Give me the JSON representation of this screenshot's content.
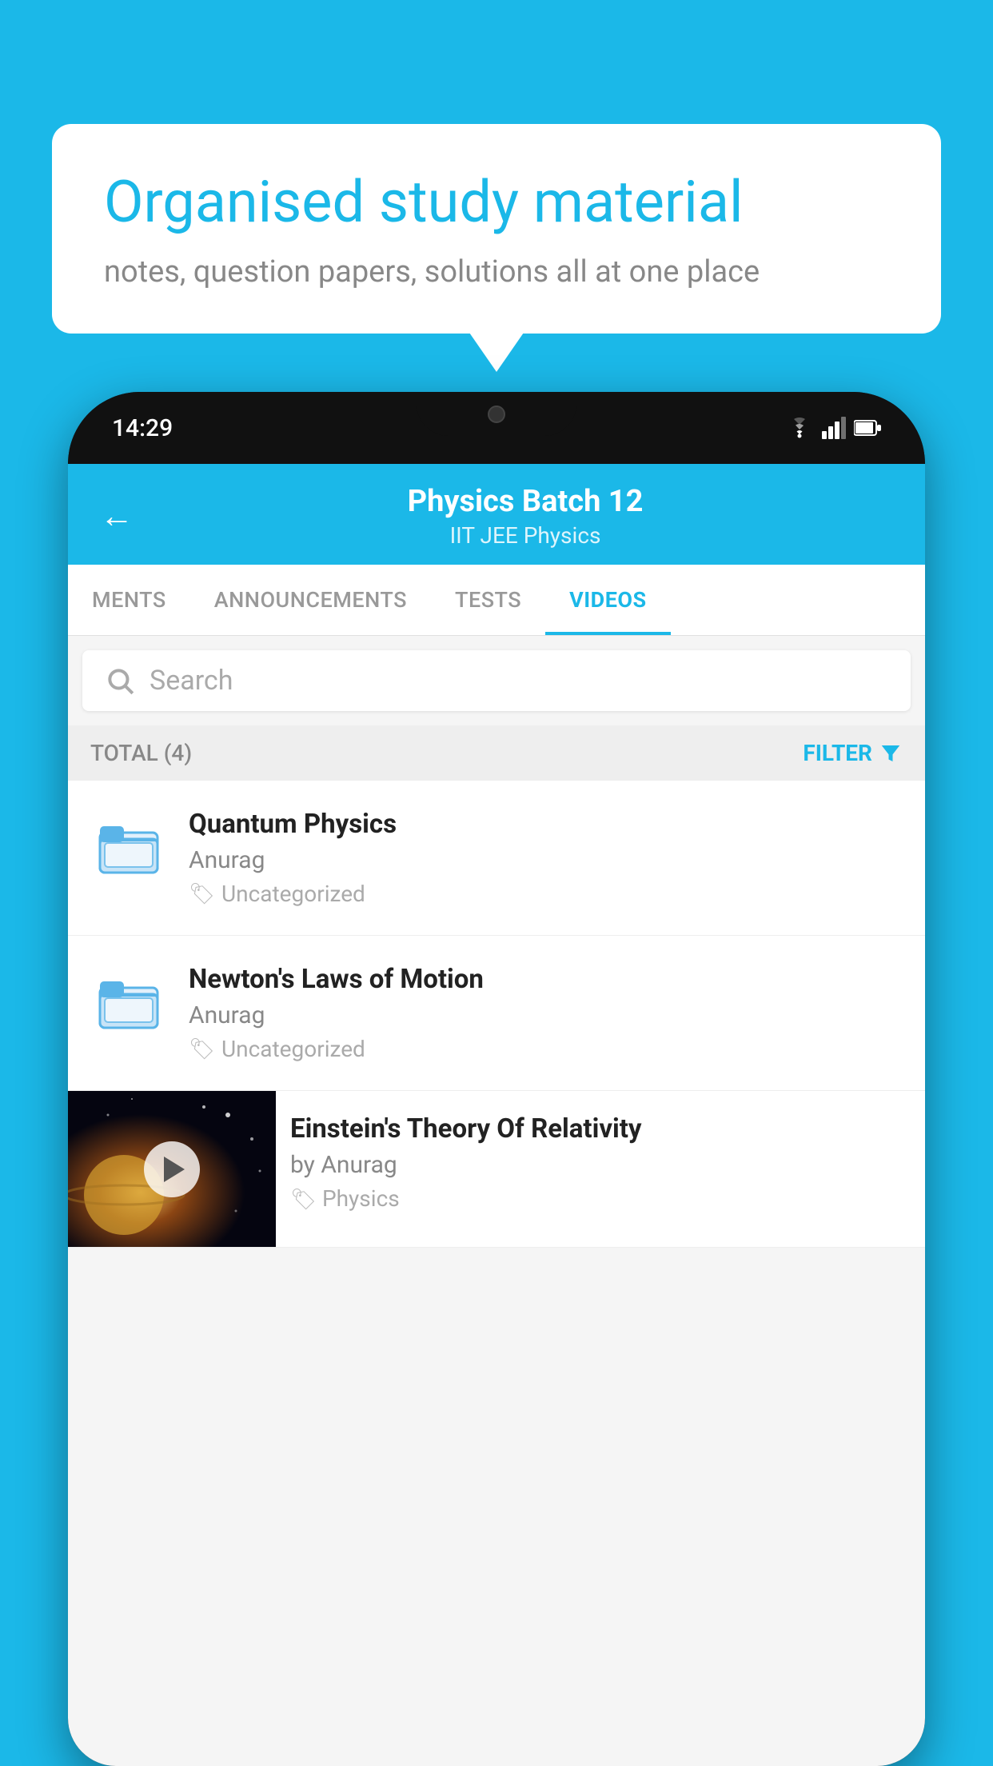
{
  "background_color": "#1bb8e8",
  "speech_bubble": {
    "headline": "Organised study material",
    "subtext": "notes, question papers, solutions all at one place"
  },
  "phone": {
    "time": "14:29",
    "app": {
      "header": {
        "title": "Physics Batch 12",
        "subtitle": "IIT JEE   Physics",
        "back_label": "←"
      },
      "tabs": [
        {
          "label": "MENTS",
          "active": false
        },
        {
          "label": "ANNOUNCEMENTS",
          "active": false
        },
        {
          "label": "TESTS",
          "active": false
        },
        {
          "label": "VIDEOS",
          "active": true
        }
      ],
      "search": {
        "placeholder": "Search"
      },
      "filter_bar": {
        "total": "TOTAL (4)",
        "filter_label": "FILTER"
      },
      "videos": [
        {
          "title": "Quantum Physics",
          "author": "Anurag",
          "tag": "Uncategorized",
          "has_thumb": false
        },
        {
          "title": "Newton's Laws of Motion",
          "author": "Anurag",
          "tag": "Uncategorized",
          "has_thumb": false
        },
        {
          "title": "Einstein's Theory Of Relativity",
          "author": "by Anurag",
          "tag": "Physics",
          "has_thumb": true
        }
      ]
    }
  }
}
